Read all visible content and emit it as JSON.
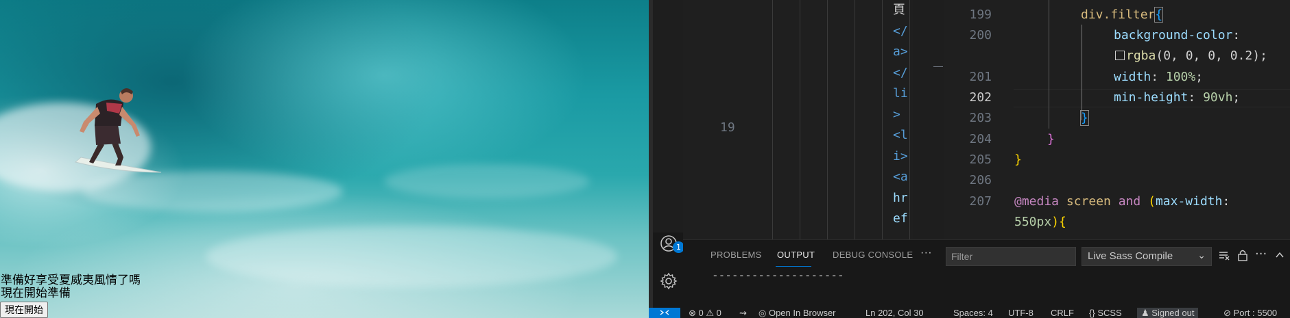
{
  "preview": {
    "headline": "準備好享受夏威夷風情了嗎",
    "subline": "現在開始準備",
    "button_label": "現在開始"
  },
  "editor_left": {
    "line_number": "19",
    "code_lines": [
      "頁",
      "</",
      "a>",
      "</",
      "li",
      ">",
      "<l",
      "i>",
      "<a",
      "",
      "hr",
      "ef"
    ]
  },
  "editor_right": {
    "line_numbers": [
      "199",
      "200",
      "201",
      "202",
      "203",
      "204",
      "205",
      "206",
      "207"
    ],
    "active_line": "202",
    "code": {
      "l199_selector": "div.filter",
      "l199_brace": "{",
      "l200_prop": "background-color",
      "l200_colon": ":",
      "l200b_fn": "rgba",
      "l200b_args": "(0, 0, 0, 0.2)",
      "l200b_semi": ";",
      "l201_prop": "width",
      "l201_colon": ": ",
      "l201_val": "100%",
      "l201_semi": ";",
      "l202_prop": "min-height",
      "l202_colon": ": ",
      "l202_val": "90vh",
      "l202_semi": ";",
      "l203_brace": "}",
      "l204_brace": "}",
      "l205_brace": "}",
      "l207_at": "@media",
      "l207_screen": " screen ",
      "l207_and": "and",
      "l207_open": " (",
      "l207_prop": "max-width",
      "l207_colon": ":",
      "l207b_val": "550px",
      "l207b_close": ")",
      "l207b_brace": "{"
    }
  },
  "panel": {
    "tabs": [
      "PROBLEMS",
      "OUTPUT",
      "DEBUG CONSOLE"
    ],
    "active_tab": "OUTPUT",
    "more_label": "···",
    "filter_placeholder": "Filter",
    "channel": "Live Sass Compile",
    "output_text": "--------------------"
  },
  "activity": {
    "account_badge": "1"
  },
  "status_bar": {
    "errors": "0",
    "warnings": "0",
    "open_in_browser": "Open In Browser",
    "position": "Ln 202, Col 30",
    "spaces": "Spaces: 4",
    "encoding": "UTF-8",
    "eol": "CRLF",
    "language": "SCSS",
    "signed_out": "Signed out",
    "port": "Port : 5500"
  },
  "colors": {
    "accent": "#0078d4",
    "editor_bg": "#1f1f1f",
    "panel_bg": "#181818"
  }
}
